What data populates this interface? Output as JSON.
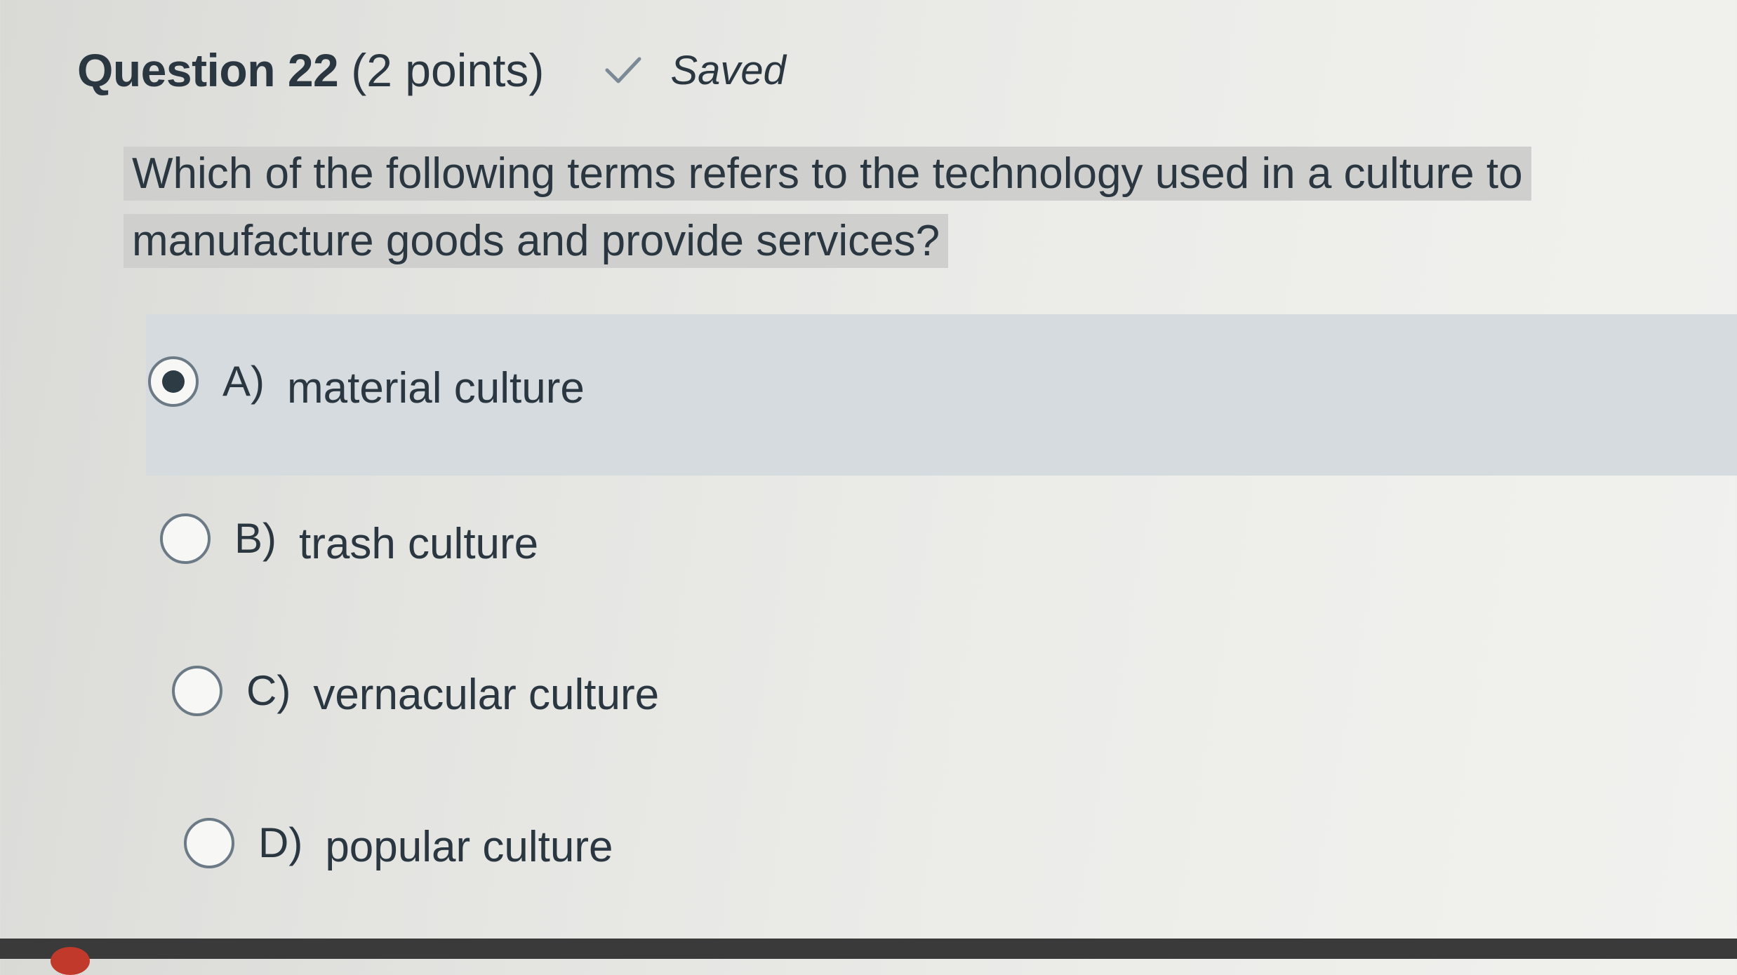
{
  "question": {
    "title": "Question 22",
    "points": "(2 points)",
    "status_label": "Saved",
    "status_icon": "check-icon",
    "text": "Which of the following terms refers to the technology used in a culture to manufacture goods and provide services?"
  },
  "options": [
    {
      "letter": "A)",
      "label": "material culture",
      "selected": true
    },
    {
      "letter": "B)",
      "label": "trash culture",
      "selected": false
    },
    {
      "letter": "C)",
      "label": "vernacular culture",
      "selected": false
    },
    {
      "letter": "D)",
      "label": "popular culture",
      "selected": false
    }
  ],
  "colors": {
    "text": "#2a3640",
    "selected_row": "#d6dbdf",
    "question_highlight": "#cfd0cd"
  }
}
